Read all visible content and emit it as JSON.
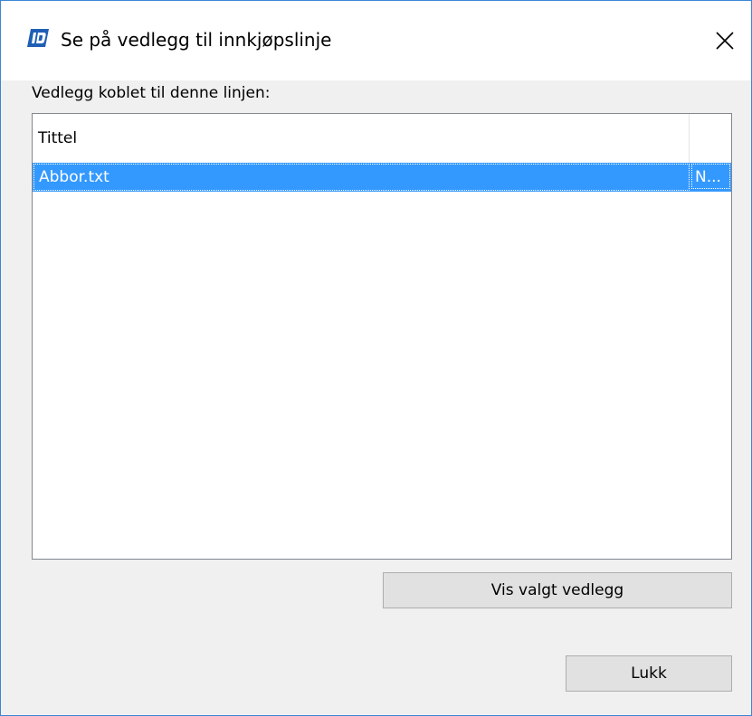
{
  "window": {
    "title": "Se på vedlegg til innkjøpslinje",
    "app_icon": "app-logo-icon",
    "close_icon": "close-icon",
    "colors": {
      "border": "#3c85d6",
      "client_bg": "#f0f0f0",
      "selection": "#3399ff"
    }
  },
  "attachments": {
    "caption": "Vedlegg koblet til denne linjen:",
    "columns": [
      "Tittel",
      ""
    ],
    "rows": [
      {
        "title": "Abbor.txt",
        "col2": "N..."
      }
    ],
    "selected_row": 0
  },
  "buttons": {
    "view_selected": "Vis valgt vedlegg",
    "close": "Lukk"
  }
}
